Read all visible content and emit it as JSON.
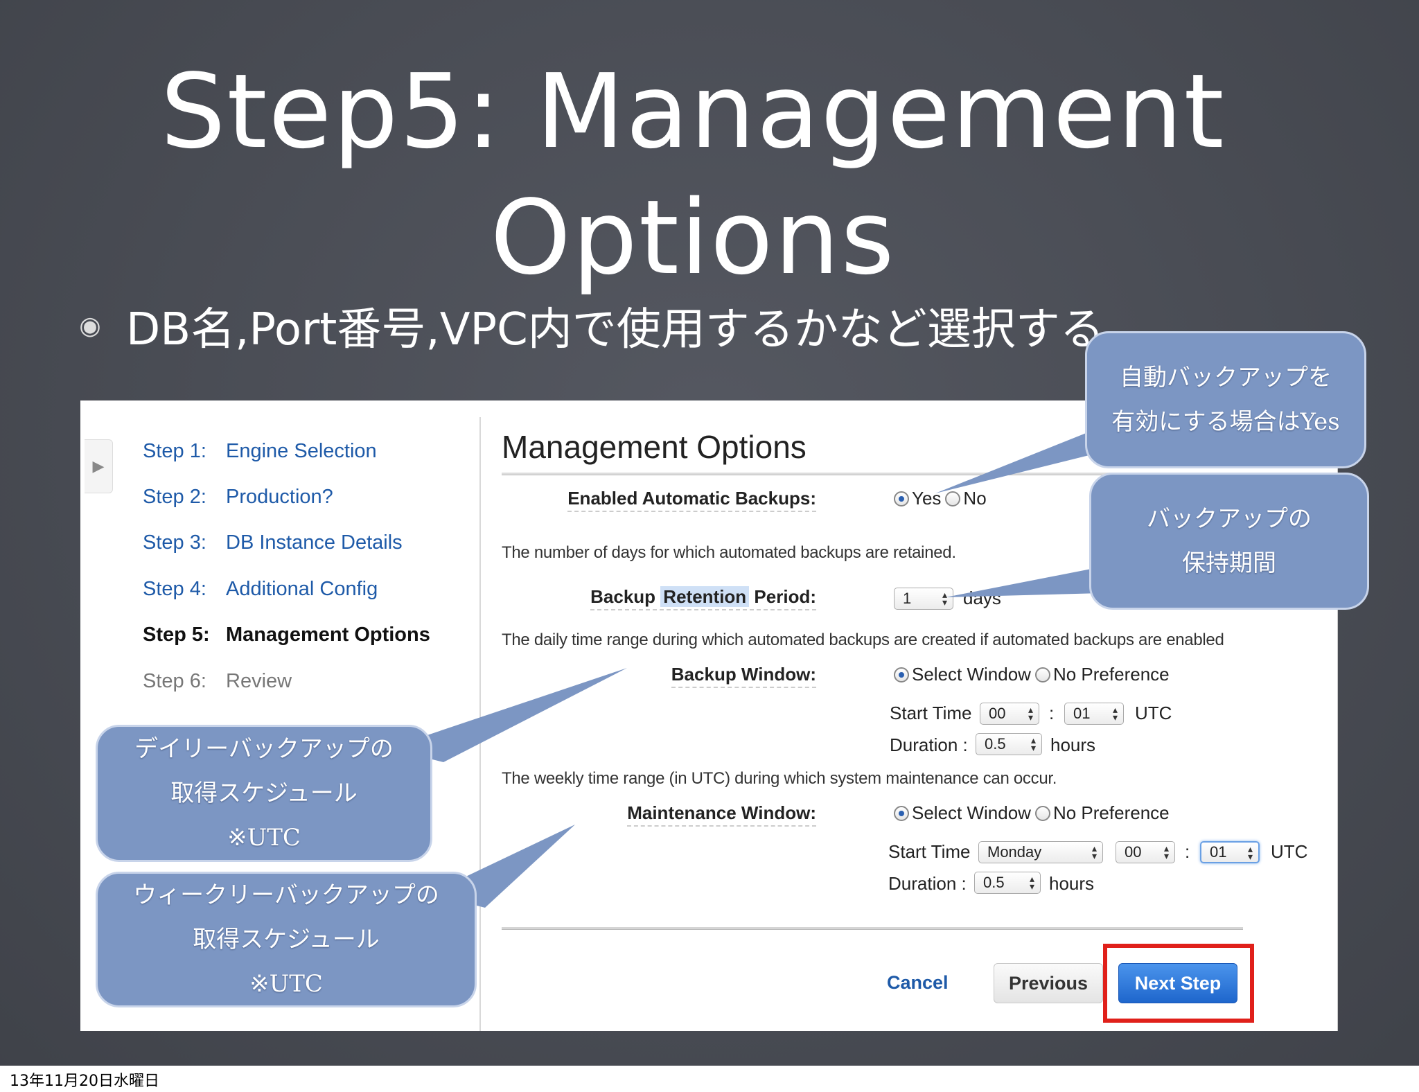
{
  "slide": {
    "title_line1": "Step5: Management",
    "title_line2": "Options",
    "bullet": "DB名,Port番号,VPC内で使用するかなど選択する",
    "date_footer": "13年11月20日水曜日"
  },
  "nav": {
    "steps": [
      {
        "num": "Step 1:",
        "label": "Engine Selection",
        "state": "link"
      },
      {
        "num": "Step 2:",
        "label": "Production?",
        "state": "link"
      },
      {
        "num": "Step 3:",
        "label": "DB Instance Details",
        "state": "link"
      },
      {
        "num": "Step 4:",
        "label": "Additional Config",
        "state": "link"
      },
      {
        "num": "Step 5:",
        "label": "Management Options",
        "state": "current"
      },
      {
        "num": "Step 6:",
        "label": "Review",
        "state": "disabled"
      }
    ]
  },
  "form": {
    "title": "Management Options",
    "auto_backups": {
      "label": "Enabled Automatic Backups:",
      "opt_yes": "Yes",
      "opt_no": "No",
      "selected": "Yes"
    },
    "retention": {
      "desc": "The number of days for which automated backups are retained.",
      "label_pre": "Backup",
      "label_hl": "Retention",
      "label_post": "Period:",
      "value": "1",
      "unit": "days"
    },
    "backup_window": {
      "desc": "The daily time range during which automated backups are created if automated backups are enabled",
      "label": "Backup Window:",
      "opt_select": "Select Window",
      "opt_none": "No Preference",
      "selected": "Select Window",
      "start_label": "Start Time",
      "start_hour": "00",
      "sep": ":",
      "start_min": "01",
      "tz": "UTC",
      "duration_label": "Duration :",
      "duration": "0.5",
      "duration_unit": "hours"
    },
    "maint_window": {
      "desc": "The weekly time range (in UTC) during which system maintenance can occur.",
      "label": "Maintenance Window:",
      "opt_select": "Select Window",
      "opt_none": "No Preference",
      "selected": "Select Window",
      "start_label": "Start Time",
      "start_day": "Monday",
      "start_hour": "00",
      "sep": ":",
      "start_min": "01",
      "tz": "UTC",
      "duration_label": "Duration :",
      "duration": "0.5",
      "duration_unit": "hours"
    },
    "buttons": {
      "cancel": "Cancel",
      "previous": "Previous",
      "next": "Next Step"
    }
  },
  "callouts": {
    "auto_backup": [
      "自動バックアップを",
      "有効にする場合はYes"
    ],
    "retention": [
      "バックアップの",
      "保持期間"
    ],
    "daily": [
      "デイリーバックアップの",
      "取得スケジュール",
      "※UTC"
    ],
    "weekly": [
      "ウィークリーバックアップの",
      "取得スケジュール",
      "※UTC"
    ]
  },
  "colors": {
    "background": "#4a4d55",
    "callout": "#7c96c3",
    "link": "#1e5aa8",
    "primary_button": "#1e66cc",
    "highlight_box": "#e0201a"
  }
}
